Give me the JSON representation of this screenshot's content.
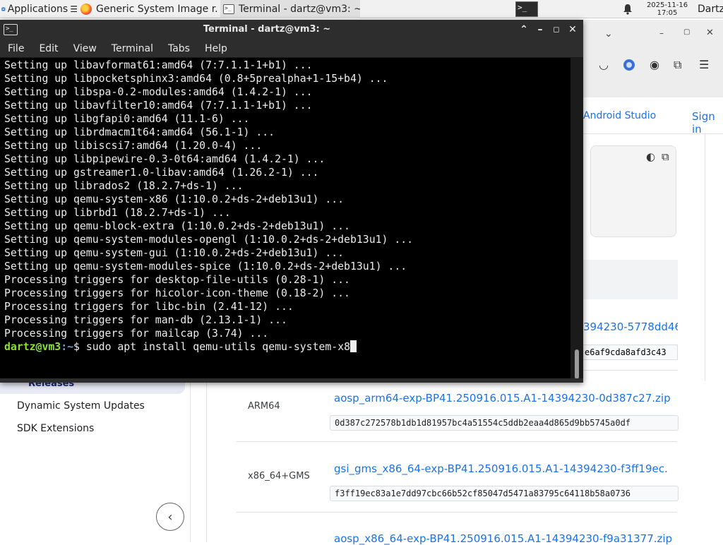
{
  "panel": {
    "applications_label": "Applications",
    "task_firefox_title": "Generic System Image r...",
    "task_terminal_title": "Terminal - dartz@vm3: ~",
    "clock_date": "2025-11-16",
    "clock_time": "17:05",
    "user": "Dartz"
  },
  "terminal": {
    "title": "Terminal - dartz@vm3: ~",
    "menu": [
      "File",
      "Edit",
      "View",
      "Terminal",
      "Tabs",
      "Help"
    ],
    "lines": [
      "Setting up libavformat61:amd64 (7:7.1.1-1+b1) ...",
      "Setting up libpocketsphinx3:amd64 (0.8+5prealpha+1-15+b4) ...",
      "Setting up libspa-0.2-modules:amd64 (1.4.2-1) ...",
      "Setting up libavfilter10:amd64 (7:7.1.1-1+b1) ...",
      "Setting up libgfapi0:amd64 (11.1-6) ...",
      "Setting up librdmacm1t64:amd64 (56.1-1) ...",
      "Setting up libiscsi7:amd64 (1.20.0-4) ...",
      "Setting up libpipewire-0.3-0t64:amd64 (1.4.2-1) ...",
      "Setting up gstreamer1.0-libav:amd64 (1.26.2-1) ...",
      "Setting up librados2 (18.2.7+ds-1) ...",
      "Setting up qemu-system-x86 (1:10.0.2+ds-2+deb13u1) ...",
      "Setting up librbd1 (18.2.7+ds-1) ...",
      "Setting up qemu-block-extra (1:10.0.2+ds-2+deb13u1) ...",
      "Setting up qemu-system-modules-opengl (1:10.0.2+ds-2+deb13u1) ...",
      "Setting up qemu-system-gui (1:10.0.2+ds-2+deb13u1) ...",
      "Setting up qemu-system-modules-spice (1:10.0.2+ds-2+deb13u1) ...",
      "Processing triggers for desktop-file-utils (0.28-1) ...",
      "Processing triggers for hicolor-icon-theme (0.18-2) ...",
      "Processing triggers for libc-bin (2.41-12) ...",
      "Processing triggers for man-db (2.13.1-1) ...",
      "Processing triggers for mailcap (3.74) ..."
    ],
    "prompt_user": "dartz@vm3",
    "prompt_sep": ":",
    "prompt_path": "~",
    "prompt_symbol": "$ ",
    "command": "sudo apt install qemu-utils qemu-system-x8"
  },
  "browser": {
    "nav_android_studio": "Android Studio",
    "nav_sign_in": "Sign in",
    "left_nav": {
      "releases": "Releases",
      "dynamic_system_updates": "Dynamic System Updates",
      "sdk_extensions": "SDK Extensions"
    },
    "fragment_link": "394230-5778dd46",
    "fragment_hash": "e6af9cda8afd3c43",
    "rows": [
      {
        "arch": "ARM64",
        "link": "aosp_arm64-exp-BP41.250916.015.A1-14394230-0d387c27.zip",
        "hash": "0d387c272578b1db1d81957bc4a51554c5ddb2eaa4d865d9bb5745a0df"
      },
      {
        "arch": "x86_64+GMS",
        "link": "gsi_gms_x86_64-exp-BP41.250916.015.A1-14394230-f3ff19ec.",
        "hash": "f3ff19ec83a1e7dd97cbc66b52cf85047d5471a83795c64118b58a0736"
      },
      {
        "arch": "",
        "link": "aosp_x86_64-exp-BP41.250916.015.A1-14394230-f9a31377.zip",
        "hash": ""
      }
    ]
  }
}
